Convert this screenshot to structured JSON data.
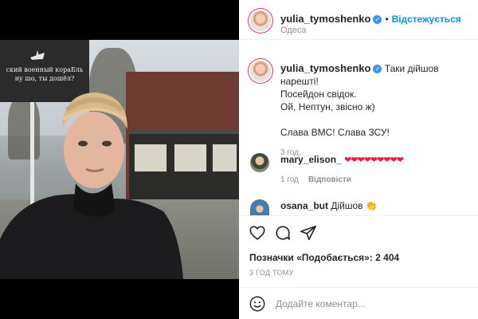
{
  "post": {
    "username": "yulia_tymoshenko",
    "follow_label": "Відстежується",
    "location": "Одеса",
    "caption_lines": [
      "Таки дійшов нарешті!",
      "Посейдон свідок.",
      "Ой, Нептун, звісно ж)",
      "",
      "Слава ВМС! Слава ЗСУ!"
    ],
    "caption_time": "3 год.",
    "billboard_lines": [
      "ский военный кораБль",
      "ну шо, ты дошёл?"
    ]
  },
  "comments": [
    {
      "username": "mary_elison_",
      "text": "❤❤❤❤❤❤❤❤❤",
      "time": "1 год",
      "reply_label": "Відповісти"
    },
    {
      "username": "osana_but",
      "text": "Дійшов 👏"
    }
  ],
  "actions": {
    "likes_label": "Позначки «Подобається»: 2 404",
    "time_ago": "3 ГОД ТОМУ"
  },
  "composer": {
    "placeholder": "Додайте коментар..."
  },
  "colors": {
    "link_blue": "#0095f6",
    "verified_blue": "#3897f0",
    "heart_red": "#ed1c3b",
    "muted_gray": "#8e8e8e"
  },
  "icons": [
    "like-icon",
    "comment-icon",
    "share-icon",
    "emoji-icon",
    "verified-icon"
  ]
}
